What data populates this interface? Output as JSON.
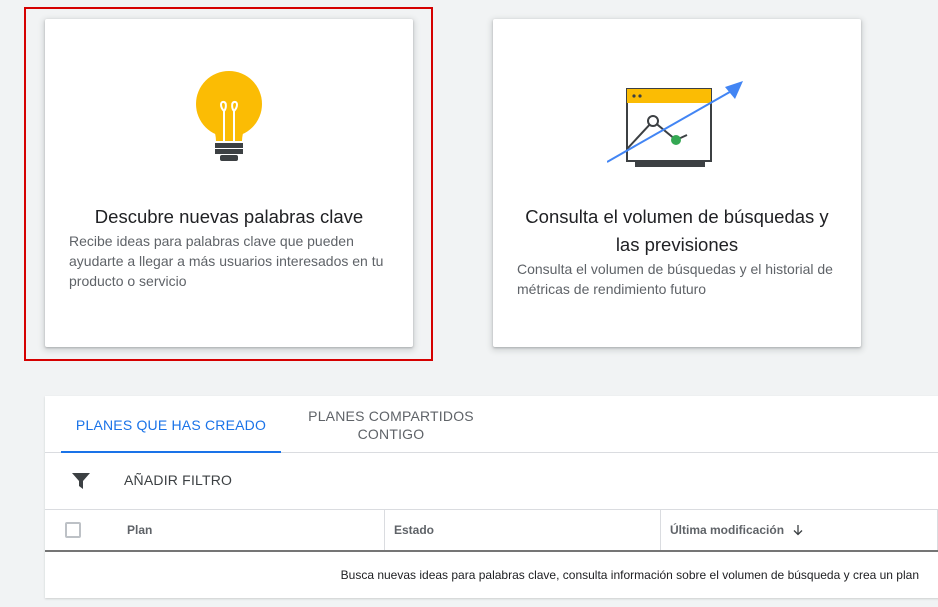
{
  "cards": [
    {
      "title": "Descubre nuevas palabras clave",
      "description": "Recibe ideas para palabras clave que pueden ayudarte a llegar a más usuarios interesados en tu producto o servicio",
      "icon": "lightbulb-icon"
    },
    {
      "title": "Consulta el volumen de búsquedas y las previsiones",
      "description": "Consulta el volumen de búsquedas y el historial de métricas de rendimiento futuro",
      "icon": "trend-chart-icon"
    }
  ],
  "tabs": [
    {
      "label": "PLANES QUE HAS CREADO",
      "active": true
    },
    {
      "label": "PLANES COMPARTIDOS CONTIGO",
      "active": false
    }
  ],
  "filter": {
    "label": "AÑADIR FILTRO",
    "icon": "filter-icon"
  },
  "table": {
    "columns": [
      "Plan",
      "Estado",
      "Última modificación"
    ],
    "sort_icon": "arrow-down-icon",
    "empty_message": "Busca nuevas ideas para palabras clave, consulta información sobre el volumen de búsqueda y crea un plan"
  },
  "colors": {
    "accent": "#1a73e8",
    "highlight": "#d50000",
    "bulb": "#fbbc04",
    "chart_point": "#34a853"
  }
}
